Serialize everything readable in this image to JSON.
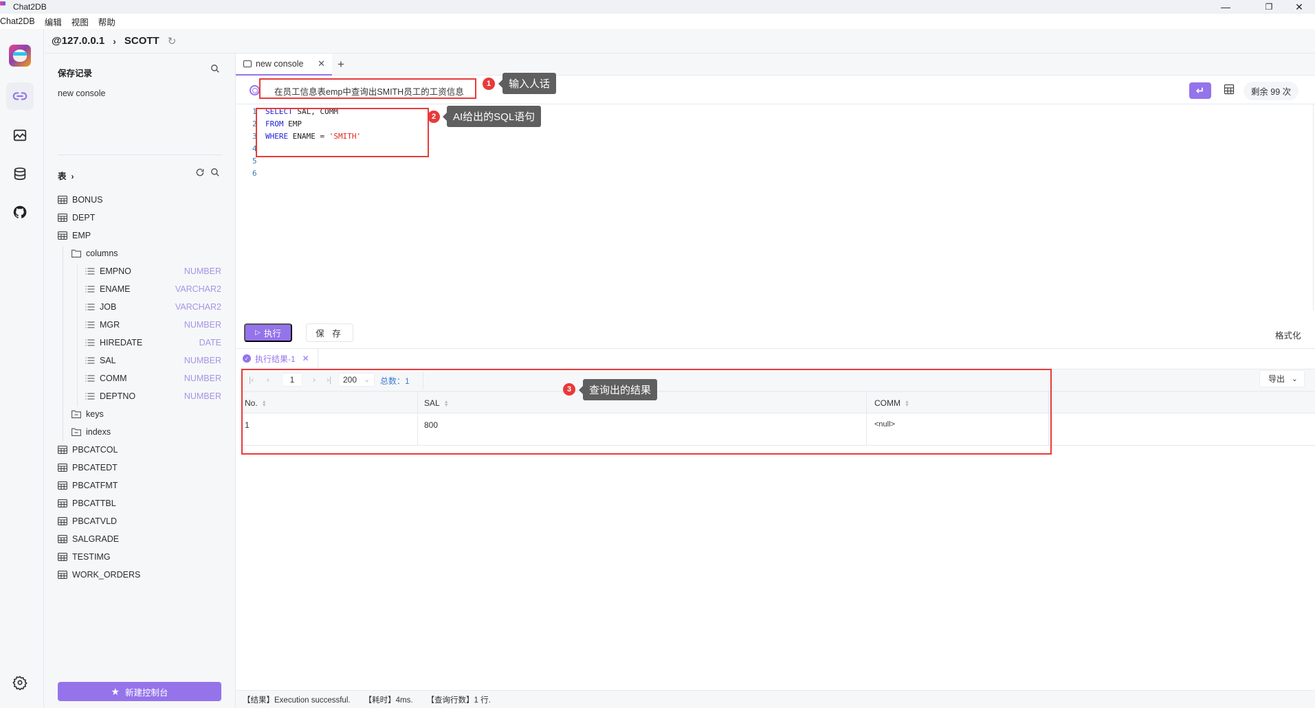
{
  "window": {
    "title": "Chat2DB",
    "controls": [
      "minimize",
      "restore",
      "close"
    ]
  },
  "menubar": [
    "Chat2DB",
    "编辑",
    "视图",
    "帮助"
  ],
  "rail": {
    "items": [
      {
        "name": "connections",
        "icon": "link-icon",
        "active": true
      },
      {
        "name": "dashboard",
        "icon": "chart-icon",
        "active": false
      },
      {
        "name": "database",
        "icon": "database-icon",
        "active": false
      },
      {
        "name": "github",
        "icon": "github-icon",
        "active": false
      }
    ],
    "settings_icon": "gear-icon"
  },
  "breadcrumb": {
    "host": "@127.0.0.1",
    "separator": "›",
    "database": "SCOTT"
  },
  "sidebar": {
    "saved_title": "保存记录",
    "saved_items": [
      "new console"
    ],
    "tables_title": "表",
    "tables": [
      {
        "name": "BONUS"
      },
      {
        "name": "DEPT"
      },
      {
        "name": "EMP",
        "expanded": true,
        "children": {
          "columns_label": "columns",
          "columns": [
            {
              "name": "EMPNO",
              "type": "NUMBER"
            },
            {
              "name": "ENAME",
              "type": "VARCHAR2"
            },
            {
              "name": "JOB",
              "type": "VARCHAR2"
            },
            {
              "name": "MGR",
              "type": "NUMBER"
            },
            {
              "name": "HIREDATE",
              "type": "DATE"
            },
            {
              "name": "SAL",
              "type": "NUMBER"
            },
            {
              "name": "COMM",
              "type": "NUMBER"
            },
            {
              "name": "DEPTNO",
              "type": "NUMBER"
            }
          ],
          "keys_label": "keys",
          "indexs_label": "indexs"
        }
      },
      {
        "name": "PBCATCOL"
      },
      {
        "name": "PBCATEDT"
      },
      {
        "name": "PBCATFMT"
      },
      {
        "name": "PBCATTBL"
      },
      {
        "name": "PBCATVLD"
      },
      {
        "name": "SALGRADE"
      },
      {
        "name": "TESTIMG"
      },
      {
        "name": "WORK_ORDERS"
      }
    ],
    "new_console_label": "新建控制台"
  },
  "tabs": [
    {
      "label": "new console",
      "active": true
    }
  ],
  "ai": {
    "prompt": "在员工信息表emp中查询出SMITH员工的工资信息",
    "remaining": "剩余 99 次"
  },
  "editor": {
    "line_numbers": [
      "1",
      "2",
      "3",
      "4",
      "5",
      "6"
    ],
    "lines": [
      [
        {
          "t": "SELECT",
          "c": "kw"
        },
        {
          "t": " SAL, COMM",
          "c": "id"
        }
      ],
      [
        {
          "t": "FROM",
          "c": "kw"
        },
        {
          "t": " EMP",
          "c": "id"
        }
      ],
      [
        {
          "t": "WHERE",
          "c": "kw"
        },
        {
          "t": " ENAME = ",
          "c": "id"
        },
        {
          "t": "'SMITH'",
          "c": "str"
        }
      ],
      [],
      [],
      []
    ]
  },
  "actions": {
    "execute": "执行",
    "save": "保 存",
    "format": "格式化"
  },
  "results": {
    "tab_label": "执行结果-1",
    "pager": {
      "page": "1",
      "page_size": "200",
      "total": "总数：1"
    },
    "export_label": "导出",
    "columns": [
      "No.",
      "SAL",
      "COMM"
    ],
    "rows": [
      [
        "1",
        "800",
        "<null>"
      ]
    ]
  },
  "annotations": [
    {
      "num": "1",
      "text": "输入人话"
    },
    {
      "num": "2",
      "text": "AI给出的SQL语句"
    },
    {
      "num": "3",
      "text": "查询出的结果"
    }
  ],
  "status": {
    "result": "【结果】Execution successful.",
    "time": "【耗时】4ms.",
    "rows": "【查询行数】1 行."
  },
  "colors": {
    "accent": "#9573eb",
    "annotation_red": "#e83a3a",
    "keyword_blue": "#1f24d6",
    "string_red": "#e1261c",
    "type_purple": "#a694e6",
    "total_blue": "#3a7bd5"
  }
}
